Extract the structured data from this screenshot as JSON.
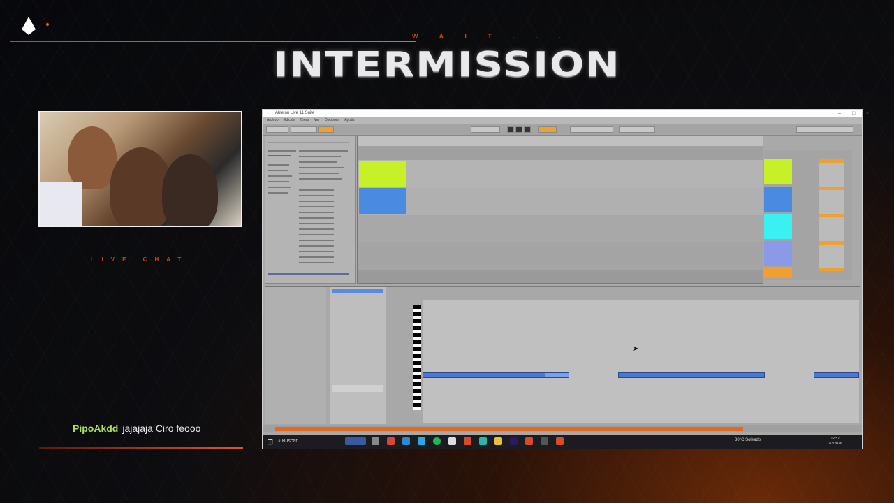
{
  "overlay": {
    "wait_text": "W A I T . . .",
    "title": "INTERMISSION",
    "live_chat_label": "LIVE CHAT",
    "chat": {
      "user": "PipoAkdd",
      "message": "jajajaja Ciro feooo"
    },
    "accent_color": "#c84a14",
    "chat_user_color": "#a8e060"
  },
  "app": {
    "title": "Ableton Live 11 Suite",
    "menu": [
      "Archivo",
      "Edición",
      "Crear",
      "Ver",
      "Opciones",
      "Ayuda"
    ],
    "clip_colors": {
      "yellow": "#c8f028",
      "blue": "#4a8ae0",
      "cyan": "#3af0f0",
      "note": "#4a78d0"
    },
    "status_color": "#e06a20"
  },
  "taskbar": {
    "search_label": "Buscar",
    "weather": "30°C Soleado",
    "clock_time": "12:57",
    "clock_date": "2/3/2026"
  },
  "icons": [
    "windows-logo-icon",
    "search-icon",
    "chrome-icon",
    "edge-icon",
    "spotify-icon",
    "explorer-icon",
    "premiere-icon"
  ]
}
